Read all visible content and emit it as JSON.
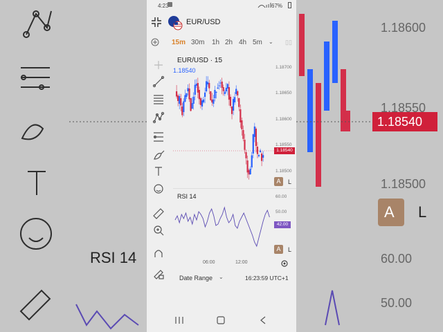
{
  "status_bar": {
    "time": "4:23",
    "battery": "67%"
  },
  "header": {
    "symbol": "EUR/USD"
  },
  "timeframes": [
    "15m",
    "30m",
    "1h",
    "2h",
    "4h",
    "5m"
  ],
  "active_timeframe": "15m",
  "chart": {
    "title": "EUR/USD · 15",
    "current_price": "1.18540",
    "price_ticks": [
      "1.18700",
      "1.18650",
      "1.18600",
      "1.18550",
      "1.18500"
    ],
    "badge_a": "A",
    "badge_l": "L"
  },
  "rsi": {
    "title": "RSI 14",
    "ticks": [
      "60.00",
      "50.00"
    ],
    "value": "42.00",
    "badge_a": "A",
    "badge_l": "L"
  },
  "time_axis": [
    "06:00",
    "12:00"
  ],
  "footer": {
    "date_range": "Date Range",
    "clock": "16:23:59 UTC+1"
  },
  "background": {
    "price_ticks": [
      "1.18600",
      "1.18550",
      "1.18500"
    ],
    "current_price": "1.18540",
    "rsi_title": "RSI 14",
    "rsi_ticks": [
      "60.00",
      "50.00"
    ],
    "badge_a": "A",
    "badge_l": "L"
  },
  "colors": {
    "accent": "#2962ff",
    "up": "#2962ff",
    "down": "#d32f4a",
    "price_label": "#d0203a",
    "rsi_line": "#5b4bb3",
    "rsi_label": "#7e57c2",
    "badge": "#a88468"
  }
}
